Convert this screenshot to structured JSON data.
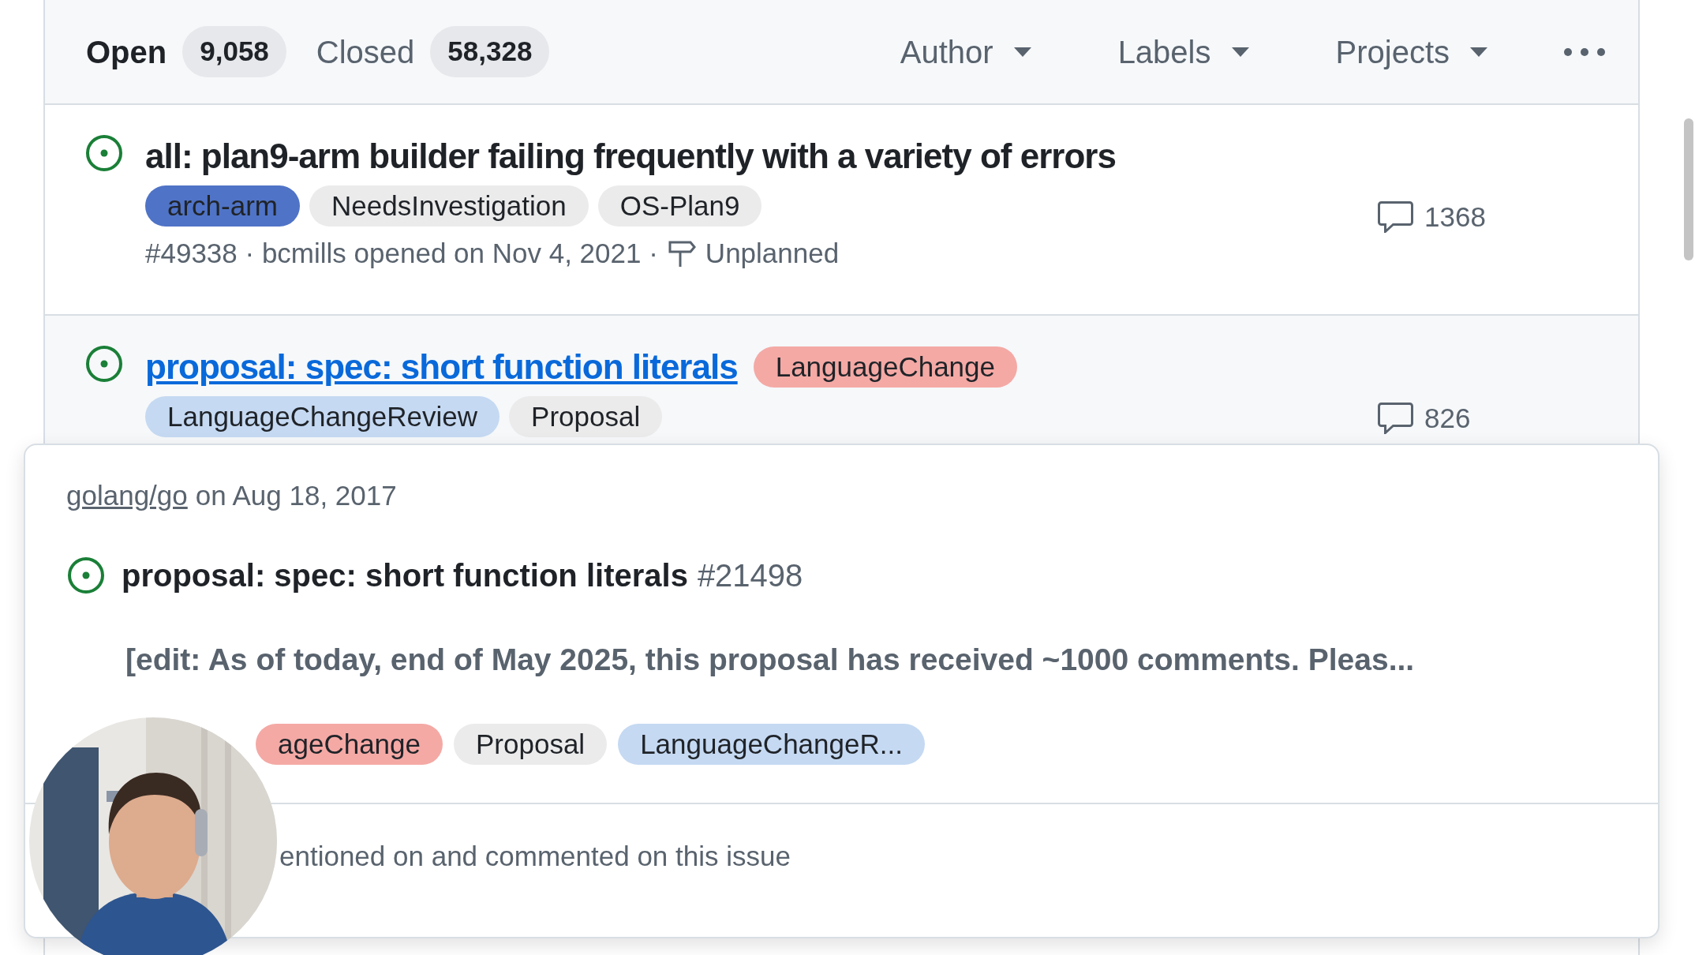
{
  "tabs": [
    {
      "label": "Open",
      "count": "9,058",
      "selected": true
    },
    {
      "label": "Closed",
      "count": "58,328",
      "selected": false
    }
  ],
  "filters": [
    {
      "label": "Author"
    },
    {
      "label": "Labels"
    },
    {
      "label": "Projects"
    }
  ],
  "issues": [
    {
      "title": "all: plan9-arm builder failing frequently with a variety of errors",
      "hovered": false,
      "labels": [
        {
          "name": "arch-arm",
          "color": "#4f73c6"
        },
        {
          "name": "NeedsInvestigation",
          "color": "#ebebeb"
        },
        {
          "name": "OS-Plan9",
          "color": "#ebebeb"
        }
      ],
      "meta": "#49338 · bcmills opened on Nov 4, 2021 ·",
      "reason": "Unplanned",
      "comments": "1368"
    },
    {
      "title": "proposal: spec: short function literals",
      "hovered": true,
      "labels": [
        {
          "name": "LanguageChange",
          "color": "#f4a9a5"
        },
        {
          "name": "LanguageChangeReview",
          "color": "#c5d9f2"
        },
        {
          "name": "Proposal",
          "color": "#ebebeb"
        }
      ],
      "comments": "826"
    }
  ],
  "hover_card": {
    "repo": "golang/go",
    "date": "on Aug 18, 2017",
    "title": "proposal: spec: short function literals",
    "number": "#21498",
    "body": "[edit: As of today, end of May 2025, this proposal has received ~1000 comments. Pleas...",
    "labels": [
      {
        "name": "ageChange",
        "color": "#f4a9a5"
      },
      {
        "name": "Proposal",
        "color": "#ebebeb"
      },
      {
        "name": "LanguageChangeR...",
        "color": "#c5d9f2"
      }
    ],
    "footer": "entioned on and commented on this issue"
  }
}
